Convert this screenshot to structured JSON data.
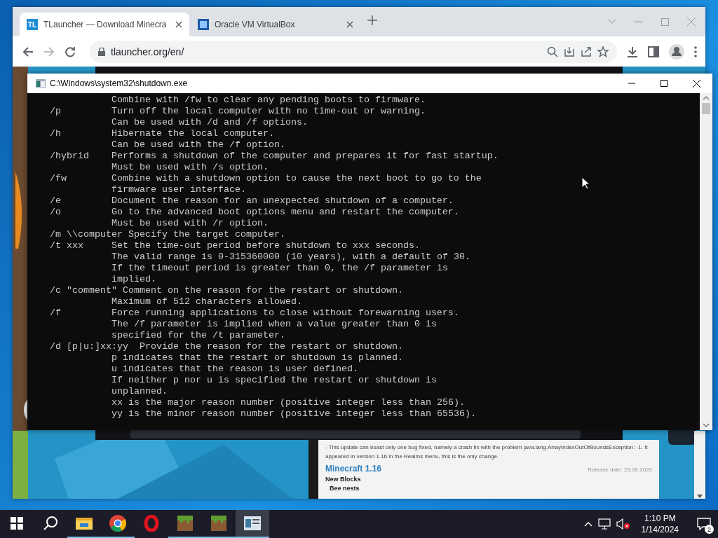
{
  "browser": {
    "tabs": [
      {
        "favicon": "TL",
        "title": "TLauncher — Download Minecra",
        "selected": true
      },
      {
        "title": "Oracle VM VirtualBox",
        "selected": false
      }
    ],
    "address": "tlauncher.org/en/",
    "page": {
      "notice": "- This update can boast only one bug fixed, namely a crash fix with the problem java.lang.ArrayIndexOutOfBoundsException: -1. It appeared in version 1.16 in the Realms menu, this is the only change.",
      "version_title": "Minecraft 1.16",
      "release_date": "Release date: 23.06.2020",
      "section": "New Blocks",
      "item": "Bee nests"
    }
  },
  "console": {
    "title": "C:\\Windows\\system32\\shutdown.exe",
    "lines": [
      {
        "kind": "cont",
        "text": "Combine with /fw to clear any pending boots to firmware."
      },
      {
        "kind": "opt",
        "text": "/p         Turn off the local computer with no time-out or warning."
      },
      {
        "kind": "cont",
        "text": "Can be used with /d and /f options."
      },
      {
        "kind": "opt",
        "text": "/h         Hibernate the local computer."
      },
      {
        "kind": "cont",
        "text": "Can be used with the /f option."
      },
      {
        "kind": "opt",
        "text": "/hybrid    Performs a shutdown of the computer and prepares it for fast startup."
      },
      {
        "kind": "cont",
        "text": "Must be used with /s option."
      },
      {
        "kind": "opt",
        "text": "/fw        Combine with a shutdown option to cause the next boot to go to the"
      },
      {
        "kind": "cont",
        "text": "firmware user interface."
      },
      {
        "kind": "opt",
        "text": "/e         Document the reason for an unexpected shutdown of a computer."
      },
      {
        "kind": "opt",
        "text": "/o         Go to the advanced boot options menu and restart the computer."
      },
      {
        "kind": "cont",
        "text": "Must be used with /r option."
      },
      {
        "kind": "opt",
        "text": "/m \\\\computer Specify the target computer."
      },
      {
        "kind": "opt",
        "text": "/t xxx     Set the time-out period before shutdown to xxx seconds."
      },
      {
        "kind": "cont",
        "text": "The valid range is 0-315360000 (10 years), with a default of 30."
      },
      {
        "kind": "cont",
        "text": "If the timeout period is greater than 0, the /f parameter is"
      },
      {
        "kind": "cont",
        "text": "implied."
      },
      {
        "kind": "opt",
        "text": "/c \"comment\" Comment on the reason for the restart or shutdown."
      },
      {
        "kind": "cont",
        "text": "Maximum of 512 characters allowed."
      },
      {
        "kind": "opt",
        "text": "/f         Force running applications to close without forewarning users."
      },
      {
        "kind": "cont",
        "text": "The /f parameter is implied when a value greater than 0 is"
      },
      {
        "kind": "cont",
        "text": "specified for the /t parameter."
      },
      {
        "kind": "opt",
        "text": "/d [p|u:]xx:yy  Provide the reason for the restart or shutdown."
      },
      {
        "kind": "cont",
        "text": "p indicates that the restart or shutdown is planned."
      },
      {
        "kind": "cont",
        "text": "u indicates that the reason is user defined."
      },
      {
        "kind": "cont",
        "text": "If neither p nor u is specified the restart or shutdown is"
      },
      {
        "kind": "cont",
        "text": "unplanned."
      },
      {
        "kind": "cont",
        "text": "xx is the major reason number (positive integer less than 256)."
      },
      {
        "kind": "cont",
        "text": "yy is the minor reason number (positive integer less than 65536)."
      }
    ]
  },
  "taskbar": {
    "apps": [
      {
        "kind": "start",
        "running": false,
        "selected": false
      },
      {
        "kind": "search",
        "running": false,
        "selected": false
      },
      {
        "kind": "folder",
        "running": true,
        "selected": false
      },
      {
        "kind": "chrome",
        "running": true,
        "selected": false
      },
      {
        "kind": "opera",
        "running": false,
        "selected": false
      },
      {
        "kind": "block",
        "running": true,
        "selected": false
      },
      {
        "kind": "block",
        "running": true,
        "selected": false
      },
      {
        "kind": "console",
        "running": true,
        "selected": true
      }
    ],
    "time": "1:10 PM",
    "date": "1/14/2024",
    "notifications": "2"
  }
}
